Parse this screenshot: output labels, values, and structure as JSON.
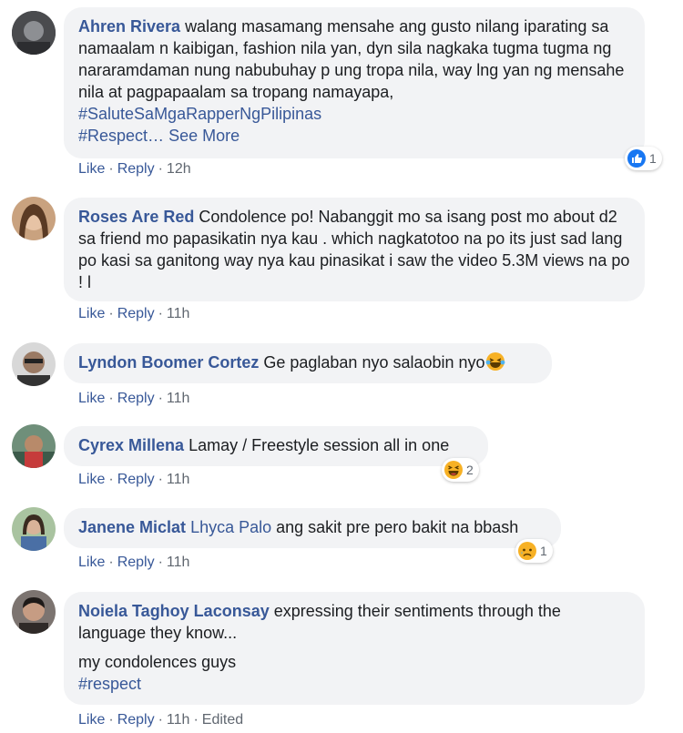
{
  "comments": [
    {
      "author": "Ahren Rivera",
      "text": "walang masamang mensahe ang gusto nilang iparating sa namaalam n kaibigan, fashion nila yan, dyn sila nagkaka tugma tugma ng nararamdaman nung nabubuhay p ung tropa nila, way lng yan ng mensahe nila at pagpapaalam sa tropang namayapa,",
      "hashtag1": "#SaluteSaMgaRapperNgPilipinas",
      "hashtag2": "#Respect",
      "see_more": "See More",
      "like": "Like",
      "reply": "Reply",
      "time": "12h",
      "reaction": {
        "icon": "like-reaction-icon",
        "count": "1"
      }
    },
    {
      "author": "Roses Are Red",
      "text": "Condolence po! Nabanggit mo sa isang post mo about d2 sa friend mo papasikatin nya kau . which nagkatotoo na po its just sad lang po kasi sa ganitong way nya kau pinasikat i saw the video 5.3M views na po ! l",
      "like": "Like",
      "reply": "Reply",
      "time": "11h"
    },
    {
      "author": "Lyndon Boomer Cortez",
      "text": "Ge paglaban nyo salaobin nyo",
      "emoji": "laughing-tears-emoji",
      "like": "Like",
      "reply": "Reply",
      "time": "11h"
    },
    {
      "author": "Cyrex Millena",
      "text": "Lamay / Freestyle session all in one",
      "like": "Like",
      "reply": "Reply",
      "time": "11h",
      "reaction": {
        "icon": "haha-reaction-icon",
        "count": "2"
      }
    },
    {
      "author": "Janene Miclat",
      "mention": "Lhyca Palo",
      "text": "ang sakit pre pero bakit na bbash",
      "like": "Like",
      "reply": "Reply",
      "time": "11h",
      "reaction": {
        "icon": "sad-reaction-icon",
        "count": "1"
      }
    },
    {
      "author": "Noiela Taghoy Laconsay",
      "text": "expressing their sentiments through the language they know...",
      "text2": "my condolences guys",
      "hashtag": "#respect",
      "like": "Like",
      "reply": "Reply",
      "time": "11h",
      "edited": "Edited"
    }
  ],
  "colors": {
    "link": "#385898",
    "meta": "#606770",
    "bubble": "#f2f3f5",
    "like_blue": "#1877f2",
    "emoji_yellow": "#f7b125"
  }
}
